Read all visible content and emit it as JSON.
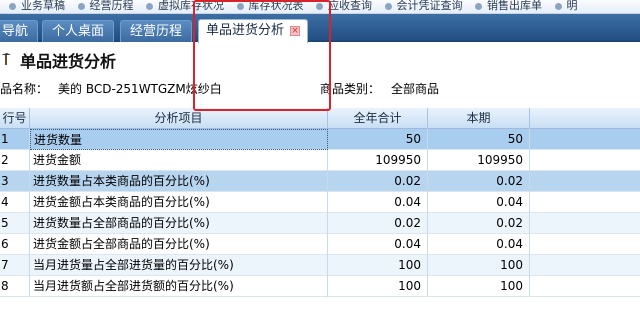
{
  "top_links": [
    "业务草稿",
    "经营历程",
    "虚拟库存状况",
    "库存状况表",
    "应收查询",
    "会计凭证查询",
    "销售出库单",
    "明"
  ],
  "tabs": [
    {
      "label": "导航"
    },
    {
      "label": "个人桌面"
    },
    {
      "label": "经营历程"
    },
    {
      "label": "单品进货分析",
      "active": true,
      "close_glyph": "×"
    }
  ],
  "page": {
    "title": "单品进货分析",
    "title_icon": "pick-hammer-icon"
  },
  "filter": {
    "product_label": "品名称：",
    "product_value": "美的 BCD-251WTGZM炫纱白",
    "category_label": "商品类别：",
    "category_value": "全部商品"
  },
  "table": {
    "headers": [
      "行号",
      "分析项目",
      "全年合计",
      "本期"
    ],
    "rows": [
      {
        "no": "1",
        "item": "进货数量",
        "total": "50",
        "current": "50"
      },
      {
        "no": "2",
        "item": "进货金额",
        "total": "109950",
        "current": "109950"
      },
      {
        "no": "3",
        "item": "进货数量占本类商品的百分比(%)",
        "total": "0.02",
        "current": "0.02"
      },
      {
        "no": "4",
        "item": "进货金额占本类商品的百分比(%)",
        "total": "0.04",
        "current": "0.04"
      },
      {
        "no": "5",
        "item": "进货数量占全部商品的百分比(%)",
        "total": "0.02",
        "current": "0.02"
      },
      {
        "no": "6",
        "item": "进货金额占全部商品的百分比(%)",
        "total": "0.04",
        "current": "0.04"
      },
      {
        "no": "7",
        "item": "当月进货量占全部进货量的百分比(%)",
        "total": "100",
        "current": "100"
      },
      {
        "no": "8",
        "item": "当月进货额占全部进货额的百分比(%)",
        "total": "100",
        "current": "100"
      }
    ]
  },
  "colors": {
    "tab_bar": "#2c5a90",
    "highlight_border": "#d9232a",
    "selected_row": "#a9cdee"
  }
}
